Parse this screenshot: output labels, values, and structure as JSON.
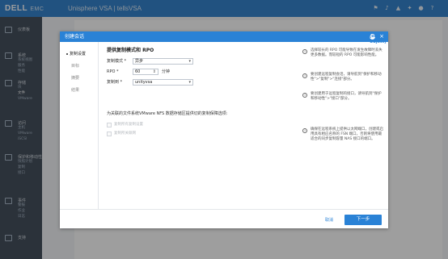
{
  "app": {
    "brand": "DELL",
    "brand_sub": "EMC",
    "title": "Unisphere VSA | tellsVSA",
    "colors": {
      "topbar": "#1c75c8",
      "dialog_header": "#2a82d6",
      "nav": "#2f3b4a"
    },
    "topbar_icons": [
      "flag-icon",
      "bell-icon",
      "alert-icon",
      "tools-icon",
      "user-icon",
      "help-icon"
    ]
  },
  "dialog": {
    "title": "创建会话",
    "help": {
      "items": [
        {
          "text": "选择较长的 RPO 可能导致在发生故障时丢失更多数据。而较短的 RPO 可能影响性能。"
        },
        {
          "text": "要创建远程复制会话，请导航到\"保护和移动性\">\"复制\">\"连接\"部分。"
        },
        {
          "text": "要创建用于远程复制的接口，请导航到\"保护和移动性\">\"接口\"部分。"
        },
        {
          "text": "确保在远程系统上提供以太网端口，创建或启用具有相应名称的 FSN 端口，否则将使用最适合的同步复制容量 NAS 接口的端口。"
        }
      ]
    },
    "close": "×",
    "steps": [
      {
        "label": "复制设置",
        "active": true
      },
      {
        "label": "目标",
        "active": false
      },
      {
        "label": "摘要",
        "active": false
      },
      {
        "label": "结果",
        "active": false
      }
    ],
    "form": {
      "heading": "提供复制模式和 RPO",
      "mode_label": "复制模式 *",
      "mode_value": "异步",
      "rpo_label": "RPO *",
      "rpo_value": "60",
      "rpo_unit": "分钟",
      "target_label": "复制到 *",
      "target_value": "unityvsa",
      "vmware_desc": "为关联的文件系统VMware NFS 数据存储区提供切的复制保障选项:",
      "options": [
        {
          "label": "复制所有复制设置"
        },
        {
          "label": "复制所关联网"
        }
      ]
    },
    "footer": {
      "cancel_label": "取消",
      "next_label": "下一步"
    }
  },
  "nav": {
    "items": [
      {
        "label": "仪表板",
        "icon": "dashboard-icon"
      },
      {
        "label": "系统",
        "icon": "system-icon",
        "subs": [
          "系统视图",
          "服务",
          "性能"
        ]
      },
      {
        "label": "存储",
        "icon": "storage-icon",
        "subs": [
          "块",
          "文件",
          "VMware"
        ]
      },
      {
        "label": "访问",
        "icon": "access-icon",
        "subs": [
          "主机",
          "VMware",
          "iSCSI"
        ]
      },
      {
        "label": "保护和移动性",
        "icon": "protection-icon",
        "subs": [
          "快照计划",
          "复制",
          "接口"
        ]
      },
      {
        "label": "事件",
        "icon": "events-icon",
        "subs": [
          "警报",
          "作业",
          "日志"
        ]
      },
      {
        "label": "支持",
        "icon": "support-icon"
      }
    ]
  }
}
